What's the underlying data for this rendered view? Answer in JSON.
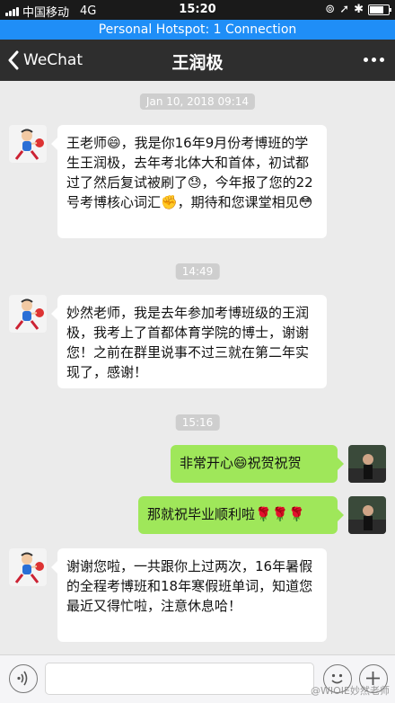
{
  "status_bar": {
    "carrier": "中国移动",
    "network": "4G",
    "time": "15:20"
  },
  "hotspot": {
    "text": "Personal Hotspot: 1 Connection"
  },
  "nav": {
    "back_label": "WeChat",
    "title": "王润极"
  },
  "timestamps": [
    "Jan 10, 2018 09:14",
    "14:49",
    "15:16"
  ],
  "messages": [
    {
      "side": "in",
      "text": "王老师😄，我是你16年9月份考博班的学生王润极，去年考北体大和首体，初试都过了然后复试被刷了😓，今年报了您的22号考博核心词汇✊，期待和您课堂相见😳"
    },
    {
      "side": "in",
      "text": "妙然老师，我是去年参加考博班级的王润极，我考上了首都体育学院的博士，谢谢您！之前在群里说事不过三就在第二年实现了，感谢！"
    },
    {
      "side": "out",
      "text": "非常开心😄祝贺祝贺"
    },
    {
      "side": "out",
      "text": "那就祝毕业顺利啦🌹🌹🌹"
    },
    {
      "side": "in",
      "text": "谢谢您啦，一共跟你上过两次，16年暑假的全程考博班和18年寒假班单词，知道您最近又得忙啦，注意休息哈！"
    }
  ],
  "watermark": "@WIOIE妙然老师"
}
